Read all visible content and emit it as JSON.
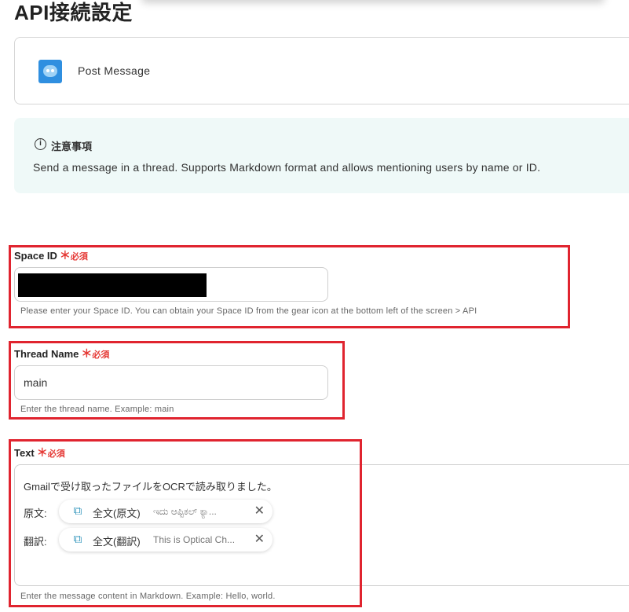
{
  "page": {
    "title": "API接続設定"
  },
  "action": {
    "name": "Post Message",
    "icon": "app-logo-icon"
  },
  "notice": {
    "title": "注意事項",
    "icon": "info-icon",
    "text": "Send a message in a thread. Supports Markdown format and allows mentioning users by name or ID."
  },
  "required_text": "必須",
  "fields": {
    "space_id": {
      "label": "Space ID",
      "value": "",
      "help": "Please enter your Space ID. You can obtain your Space ID from the gear icon at the bottom left of the screen > API"
    },
    "thread_name": {
      "label": "Thread Name",
      "value": "main",
      "help": "Enter the thread name. Example: main"
    },
    "text": {
      "label": "Text",
      "line1": "Gmailで受け取ったファイルをOCRで読み取りました。",
      "rows": [
        {
          "label": "原文:",
          "chip_name": "全文(原文)",
          "chip_preview": "ಇದು ಆಪ್ಟಿಕಲ್ ಕ್ಯಾ..."
        },
        {
          "label": "翻訳:",
          "chip_name": "全文(翻訳)",
          "chip_preview": "This is Optical Ch..."
        }
      ],
      "help": "Enter the message content in Markdown. Example: Hello, world."
    }
  },
  "colors": {
    "highlight": "#e0242f",
    "required": "#e53935",
    "notice_bg": "#eff9f8"
  }
}
